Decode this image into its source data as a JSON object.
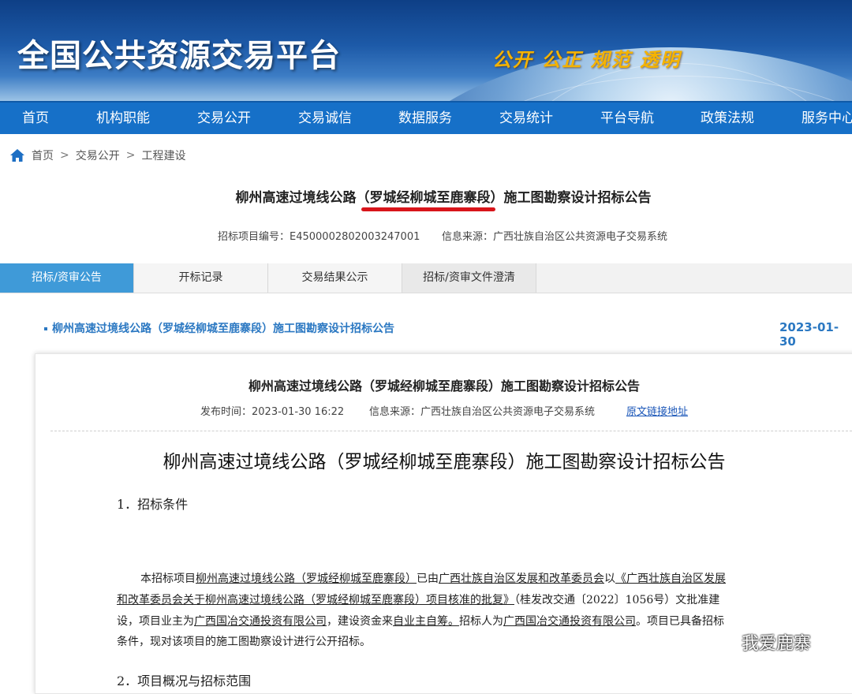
{
  "banner": {
    "site_title": "全国公共资源交易平台",
    "slogan": "公开 公正 规范 透明"
  },
  "nav": {
    "items": [
      "首页",
      "机构职能",
      "交易公开",
      "交易诚信",
      "数据服务",
      "交易统计",
      "平台导航",
      "政策法规",
      "服务中心"
    ]
  },
  "breadcrumb": {
    "items": [
      "首页",
      "交易公开",
      "工程建设"
    ],
    "separator": ">"
  },
  "header": {
    "title": "柳州高速过境线公路（罗城经柳城至鹿寨段）施工图勘察设计招标公告",
    "project_no": "招标项目编号：E4500002802003247001",
    "source": "信息来源：广西壮族自治区公共资源电子交易系统"
  },
  "tabs": [
    {
      "label": "招标/资审公告"
    },
    {
      "label": "开标记录"
    },
    {
      "label": "交易结果公示"
    },
    {
      "label": "招标/资审文件澄清"
    }
  ],
  "notice": {
    "link_text": "柳州高速过境线公路（罗城经柳城至鹿寨段）施工图勘察设计招标公告",
    "date": "2023-01-30"
  },
  "detail": {
    "title": "柳州高速过境线公路（罗城经柳城至鹿寨段）施工图勘察设计招标公告",
    "publish_time": "发布时间：2023-01-30 16:22",
    "source": "信息来源：广西壮族自治区公共资源电子交易系统",
    "source_link": "原文链接地址",
    "doc_title": "柳州高速过境线公路（罗城经柳城至鹿寨段）施工图勘察设计招标公告",
    "section1": "1．招标条件",
    "section2": "2．项目概况与招标范围",
    "para": {
      "l1_a": "本招标项目",
      "l1_b": "柳州高速过境线公路（罗城经柳城至鹿寨段）",
      "l1_c": "已由",
      "l1_d": "广西壮族自治区发展和改革委员会",
      "l1_e": "以",
      "l1_f": "《广西壮族自治区发展",
      "l2_a": "和改革委员会关于柳州高速过境线公路（罗城经柳城至鹿寨段）项目核准的批复》",
      "l2_b": "（桂发改交通〔2022〕1056号）",
      "l2_c": "文批准建",
      "l3_a": "设，项目业主为",
      "l3_b": "广西国冶交通投资有限公司",
      "l3_c": "，建设资金来",
      "l3_d": "自业主自筹。",
      "l3_e": "招标人为",
      "l3_f": "广西国冶交通投资有限公司",
      "l3_g": "。项目已具备招标",
      "l4": "条件，现对该项目的施工图勘察设计进行公开招标。"
    }
  },
  "watermark": {
    "text": "我爱鹿寨"
  }
}
